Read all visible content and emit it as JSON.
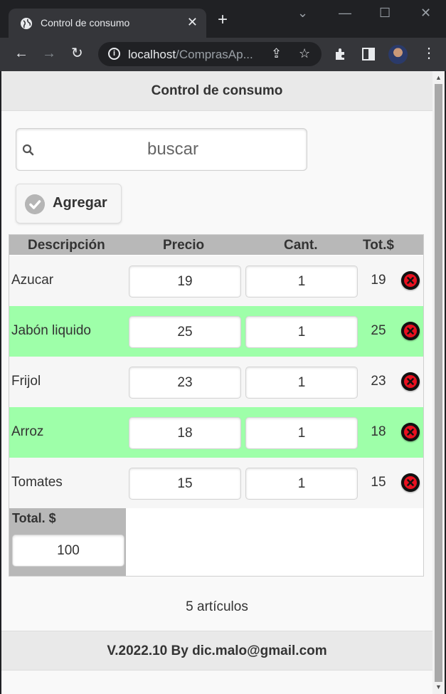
{
  "browser": {
    "tab_title": "Control de consumo",
    "url_host": "localhost",
    "url_path": "/ComprasAp..."
  },
  "app": {
    "header_title": "Control de consumo",
    "search_placeholder": "buscar",
    "add_label": "Agregar",
    "columns": [
      "Descripción",
      "Precio",
      "Cant.",
      "Tot.$"
    ],
    "items": [
      {
        "descripcion": "Azucar",
        "precio": "19",
        "cantidad": "1",
        "total": "19"
      },
      {
        "descripcion": "Jabón liquido",
        "precio": "25",
        "cantidad": "1",
        "total": "25"
      },
      {
        "descripcion": "Frijol",
        "precio": "23",
        "cantidad": "1",
        "total": "23"
      },
      {
        "descripcion": "Arroz",
        "precio": "18",
        "cantidad": "1",
        "total": "18"
      },
      {
        "descripcion": "Tomates",
        "precio": "15",
        "cantidad": "1",
        "total": "15"
      }
    ],
    "total_label": "Total. $",
    "total_value": "100",
    "count_text": "5 artículos",
    "footer_text": "V.2022.10 By dic.malo@gmail.com"
  },
  "colors": {
    "alt_row": "#9effa9",
    "header_bg": "#e9e9e9",
    "table_head": "#b8b8b8",
    "delete_red": "#e8101f"
  },
  "icons": [
    "globe-icon",
    "close-icon",
    "plus-icon",
    "back-icon",
    "forward-icon",
    "reload-icon",
    "info-icon",
    "share-icon",
    "star-icon",
    "extensions-icon",
    "sidepanel-icon",
    "menu-icon",
    "search-icon",
    "check-icon",
    "delete-icon"
  ]
}
